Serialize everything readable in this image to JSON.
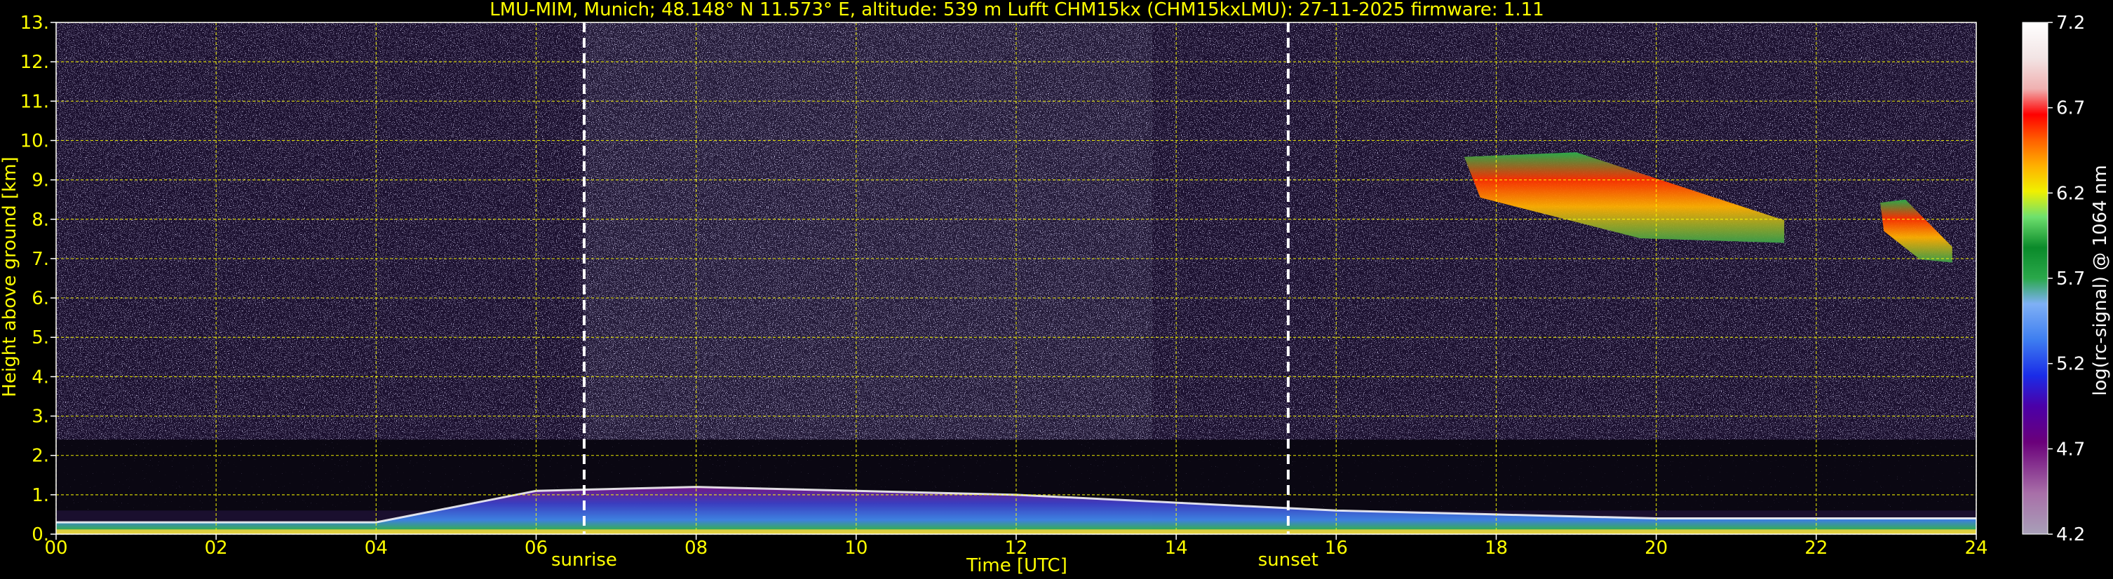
{
  "chart_data": {
    "type": "heatmap",
    "title": "LMU-MIM, Munich; 48.148° N 11.573° E, altitude: 539 m    Lufft CHM15kx (CHM15kxLMU): 27-11-2025    firmware: 1.11",
    "xlabel": "Time [UTC]",
    "ylabel": "Height above ground [km]",
    "xlim": [
      0,
      24
    ],
    "ylim": [
      0,
      13
    ],
    "x_ticks": [
      "00",
      "02",
      "04",
      "06",
      "08",
      "10",
      "12",
      "14",
      "16",
      "18",
      "20",
      "22",
      "24"
    ],
    "y_ticks": [
      "0.",
      "1.",
      "2.",
      "3.",
      "4.",
      "5.",
      "6.",
      "7.",
      "8.",
      "9.",
      "10.",
      "11.",
      "12.",
      "13."
    ],
    "grid": true,
    "annotations": [
      {
        "label": "sunrise",
        "x": 6.6
      },
      {
        "label": "sunset",
        "x": 15.4
      }
    ],
    "colorbar": {
      "label": "log(rc-signal) @ 1064 nm",
      "range": [
        4.2,
        7.2
      ],
      "ticks": [
        "4.2",
        "4.7",
        "5.2",
        "5.7",
        "6.2",
        "6.7",
        "7.2"
      ]
    },
    "features": [
      {
        "name": "boundary layer aerosol",
        "x_start": 0,
        "x_end": 24,
        "top_km": [
          0.3,
          0.3,
          0.3,
          1.1,
          1.2,
          1.1,
          1.0,
          0.8,
          0.6,
          0.5,
          0.4,
          0.4,
          0.4
        ]
      },
      {
        "name": "cirrus cloud",
        "x_start": 17.6,
        "x_end": 21.6,
        "base_km": 7.4,
        "top_km": 9.7
      },
      {
        "name": "cirrus cloud",
        "x_start": 22.8,
        "x_end": 23.7,
        "base_km": 6.9,
        "top_km": 8.5
      }
    ]
  },
  "colors": {
    "axis_text": "#ffff00",
    "grid": "#ffff00",
    "annotation_line": "#ffffff",
    "colorbar_label": "#ffffff"
  }
}
